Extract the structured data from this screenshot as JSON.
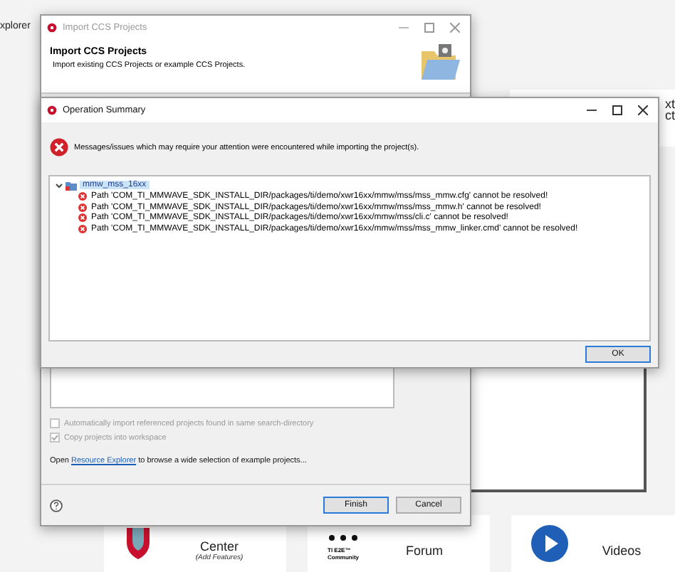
{
  "background": {
    "explorer_label": "xplorer",
    "side_text": [
      "xt",
      "ct"
    ],
    "cards": [
      {
        "kind": "shield",
        "title": "Center",
        "subtitle": "(Add Features)"
      },
      {
        "kind": "community",
        "logo_text": "TI E2E™ Community",
        "title": "Forum"
      },
      {
        "kind": "play",
        "title": "Videos"
      }
    ]
  },
  "import_dialog": {
    "title": "Import CCS Projects",
    "header_title": "Import CCS Projects",
    "header_subtitle": "Import existing CCS Projects or example CCS Projects.",
    "options": [
      {
        "label": "Automatically import referenced projects found in same search-directory",
        "checked": false,
        "disabled": true
      },
      {
        "label": "Copy projects into workspace",
        "checked": true,
        "disabled": true
      }
    ],
    "link_prefix": "Open",
    "link": "Resource Explorer",
    "link_suffix": "to browse a wide selection of example projects...",
    "buttons": [
      {
        "label": "Finish",
        "default": true
      },
      {
        "label": "Cancel",
        "default": false
      }
    ]
  },
  "summary_dialog": {
    "title": "Operation Summary",
    "message": "Messages/issues which may require your attention were encountered while importing the project(s).",
    "tree": [
      {
        "label": "mmw_mss_16xx",
        "selected": true,
        "expanded": true,
        "children": [
          {
            "label": "Path 'COM_TI_MMWAVE_SDK_INSTALL_DIR/packages/ti/demo/xwr16xx/mmw/mss/mss_mmw.cfg' cannot be resolved!"
          },
          {
            "label": "Path 'COM_TI_MMWAVE_SDK_INSTALL_DIR/packages/ti/demo/xwr16xx/mmw/mss/mss_mmw.h' cannot be resolved!"
          },
          {
            "label": "Path 'COM_TI_MMWAVE_SDK_INSTALL_DIR/packages/ti/demo/xwr16xx/mmw/mss/cli.c' cannot be resolved!"
          },
          {
            "label": "Path 'COM_TI_MMWAVE_SDK_INSTALL_DIR/packages/ti/demo/xwr16xx/mmw/mss/mss_mmw_linker.cmd' cannot be resolved!"
          }
        ]
      }
    ],
    "buttons": [
      {
        "label": "OK",
        "default": true
      }
    ]
  }
}
